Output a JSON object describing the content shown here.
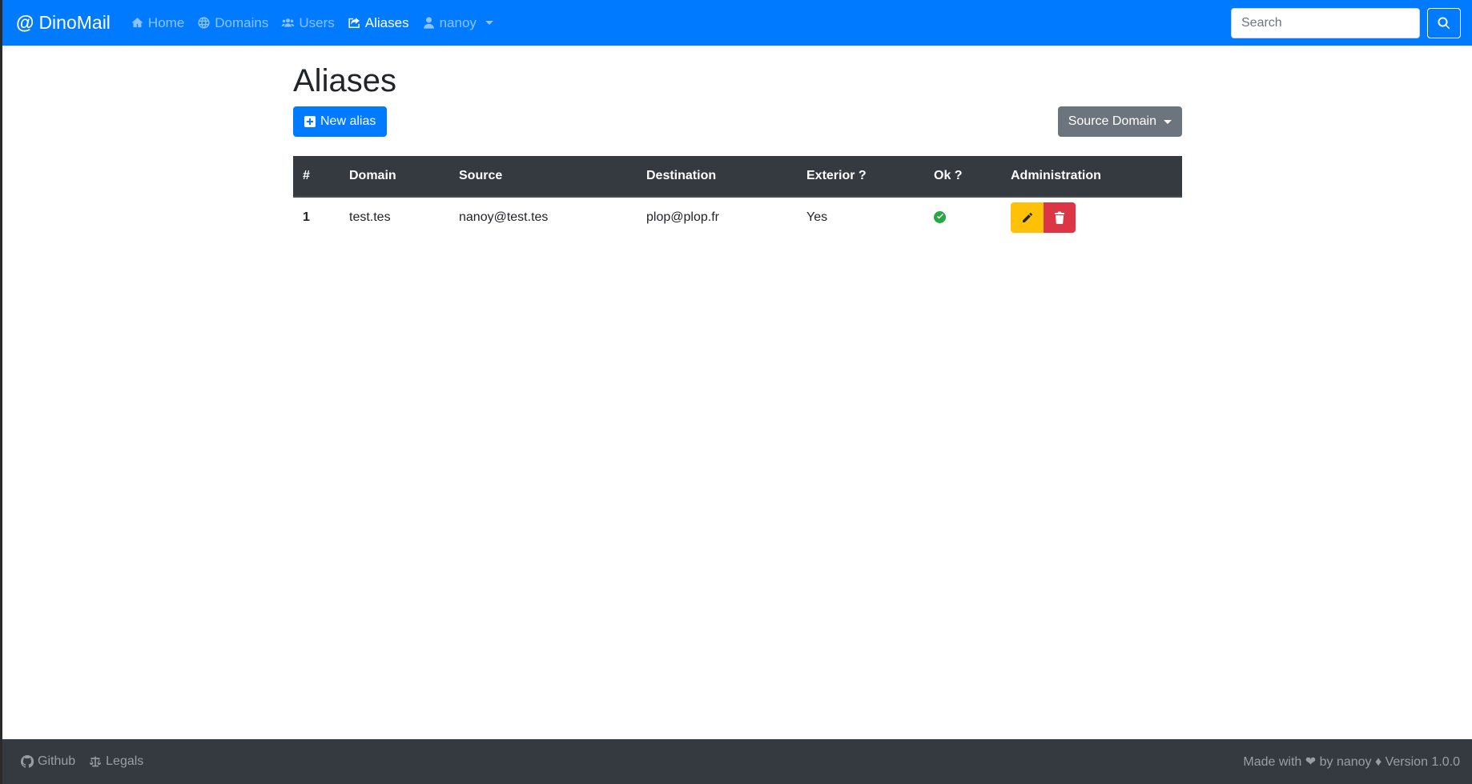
{
  "navbar": {
    "brand_symbol": "@",
    "brand_name": "DinoMail",
    "items": [
      {
        "label": "Home",
        "icon": "home-icon",
        "active": false
      },
      {
        "label": "Domains",
        "icon": "globe-icon",
        "active": false
      },
      {
        "label": "Users",
        "icon": "users-icon",
        "active": false
      },
      {
        "label": "Aliases",
        "icon": "share-icon",
        "active": true
      },
      {
        "label": "nanoy",
        "icon": "user-icon",
        "active": false,
        "dropdown": true
      }
    ],
    "search_placeholder": "Search",
    "color": "#007bff"
  },
  "main": {
    "title": "Aliases",
    "new_button_label": "New alias",
    "filter_label": "Source Domain"
  },
  "table": {
    "headers": [
      "#",
      "Domain",
      "Source",
      "Destination",
      "Exterior ?",
      "Ok ?",
      "Administration"
    ],
    "rows": [
      {
        "index": "1",
        "domain": "test.tes",
        "source": "nanoy@test.tes",
        "destination": "plop@plop.fr",
        "exterior": "Yes",
        "ok": true
      }
    ]
  },
  "footer": {
    "github_label": "Github",
    "legals_label": "Legals",
    "credit": "Made with ❤ by nanoy ♦ Version 1.0.0"
  },
  "colors": {
    "primary": "#007bff",
    "dark": "#343a40",
    "warning": "#ffc107",
    "danger": "#dc3545",
    "success": "#28a745",
    "secondary": "#6c757d"
  }
}
